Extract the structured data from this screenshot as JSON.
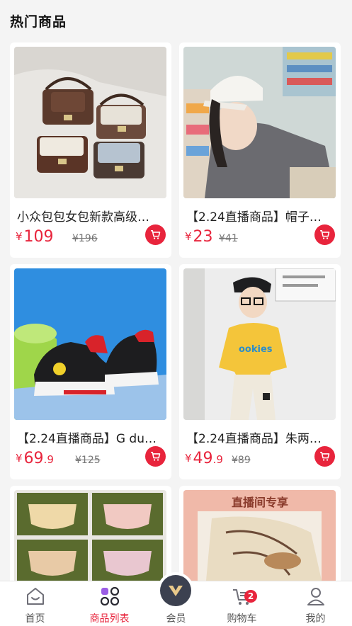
{
  "header": {
    "title": "热门商品"
  },
  "products": [
    {
      "name": "小众包包女包新款高级…",
      "yen": "¥",
      "price_int": "109",
      "price_dec": "",
      "original": "¥196"
    },
    {
      "name": "【2.24直播商品】帽子…",
      "yen": "¥",
      "price_int": "23",
      "price_dec": "",
      "original": "¥41"
    },
    {
      "name": "【2.24直播商品】G du…",
      "yen": "¥",
      "price_int": "69",
      "price_dec": ".9",
      "original": "¥125"
    },
    {
      "name": "【2.24直播商品】朱两…",
      "yen": "¥",
      "price_int": "49",
      "price_dec": ".9",
      "original": "¥89"
    },
    {
      "name": "",
      "image_text": ""
    },
    {
      "name": "",
      "image_text": "直播间专享"
    }
  ],
  "tabbar": {
    "items": [
      {
        "label": "首页",
        "icon": "home-icon"
      },
      {
        "label": "商品列表",
        "icon": "grid-icon",
        "active": true
      },
      {
        "label": "会员",
        "icon": "vip-icon"
      },
      {
        "label": "购物车",
        "icon": "cart-icon",
        "badge": "2"
      },
      {
        "label": "我的",
        "icon": "user-icon"
      }
    ]
  },
  "colors": {
    "accent": "#e8243c",
    "background": "#f4f4f4"
  }
}
